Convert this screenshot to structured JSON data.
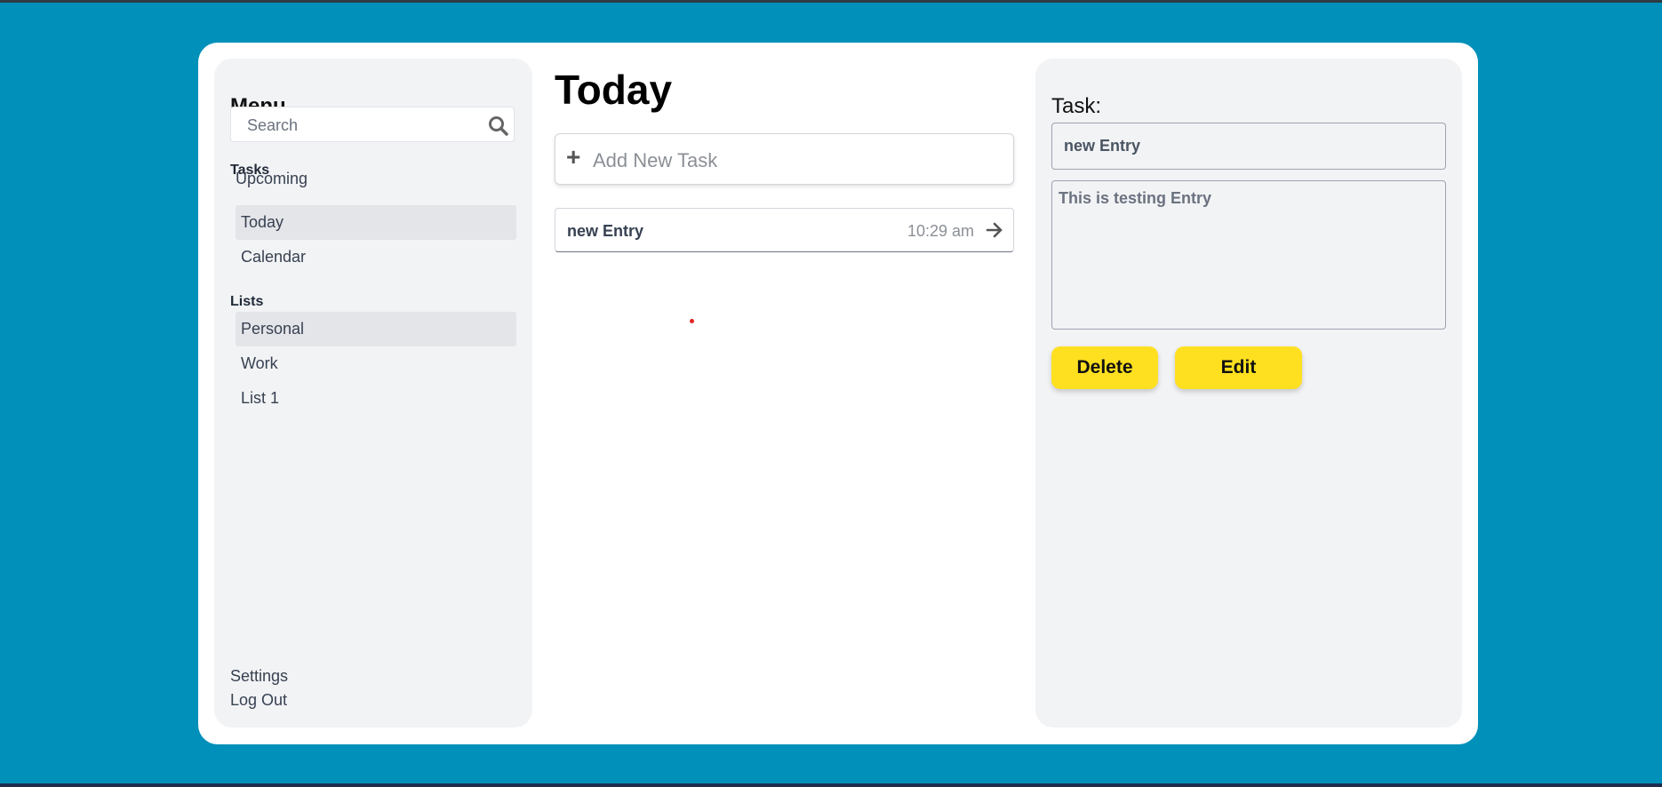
{
  "sidebar": {
    "title": "Menu",
    "search_placeholder": "Search",
    "tasks_label": "Tasks",
    "tasks_items": [
      {
        "label": "Upcoming"
      },
      {
        "label": "Today"
      },
      {
        "label": "Calendar"
      }
    ],
    "lists_label": "Lists",
    "lists_items": [
      {
        "label": "Personal"
      },
      {
        "label": "Work"
      },
      {
        "label": "List 1"
      }
    ],
    "settings_label": "Settings",
    "logout_label": "Log Out"
  },
  "main": {
    "title": "Today",
    "add_task_placeholder": "Add New Task",
    "tasks": [
      {
        "name": "new Entry",
        "time": "10:29 am"
      }
    ]
  },
  "detail": {
    "title": "Task:",
    "task_title": "new Entry",
    "task_description": "This is testing Entry",
    "delete_label": "Delete",
    "edit_label": "Edit"
  },
  "colors": {
    "background": "#0090b9",
    "button_accent": "#ffe020",
    "panel": "#f2f3f5"
  }
}
